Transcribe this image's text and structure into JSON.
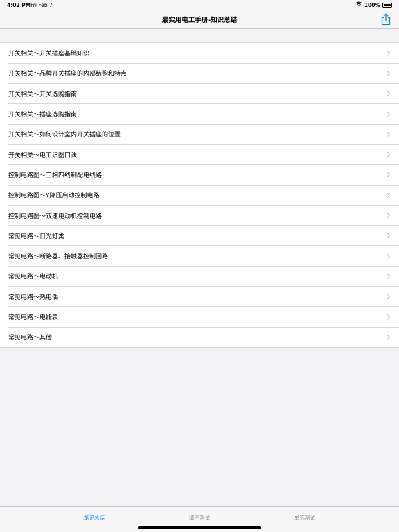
{
  "status": {
    "time": "4:02 PM",
    "date": "Fri Feb 7",
    "battery": "100%",
    "battery_level": 1.0
  },
  "nav": {
    "title": "最实用电工手册-知识总结",
    "share_icon": "share-icon"
  },
  "items": [
    {
      "label": "开关相关～开关插座基础知识"
    },
    {
      "label": "开关相关～品牌开关插座的内部结购和特点"
    },
    {
      "label": "开关相关～开关选购指南"
    },
    {
      "label": "开关相关～插座选购指南"
    },
    {
      "label": "开关相关～如何设计室内开关插座的位置"
    },
    {
      "label": "开关相关～电工识图口诀"
    },
    {
      "label": "控制电路图～三相四线制配电线路"
    },
    {
      "label": "控制电路图～Y降压启动控制电路"
    },
    {
      "label": "控制电路图～双速电动机控制电路"
    },
    {
      "label": "常见电路～日光灯类"
    },
    {
      "label": "常见电路～断路器、接触器控制回路"
    },
    {
      "label": "常见电路～电动机"
    },
    {
      "label": "常见电路～热电偶"
    },
    {
      "label": "常见电路～电能表"
    },
    {
      "label": "常见电路～其他"
    }
  ],
  "tabs": [
    {
      "label": "笔记总结",
      "active": true
    },
    {
      "label": "填空测试",
      "active": false
    },
    {
      "label": "单选测试",
      "active": false
    }
  ],
  "colors": {
    "accent": "#1a7ef5",
    "inactive_tab": "#8e8e93",
    "background": "#f2f2f7"
  }
}
